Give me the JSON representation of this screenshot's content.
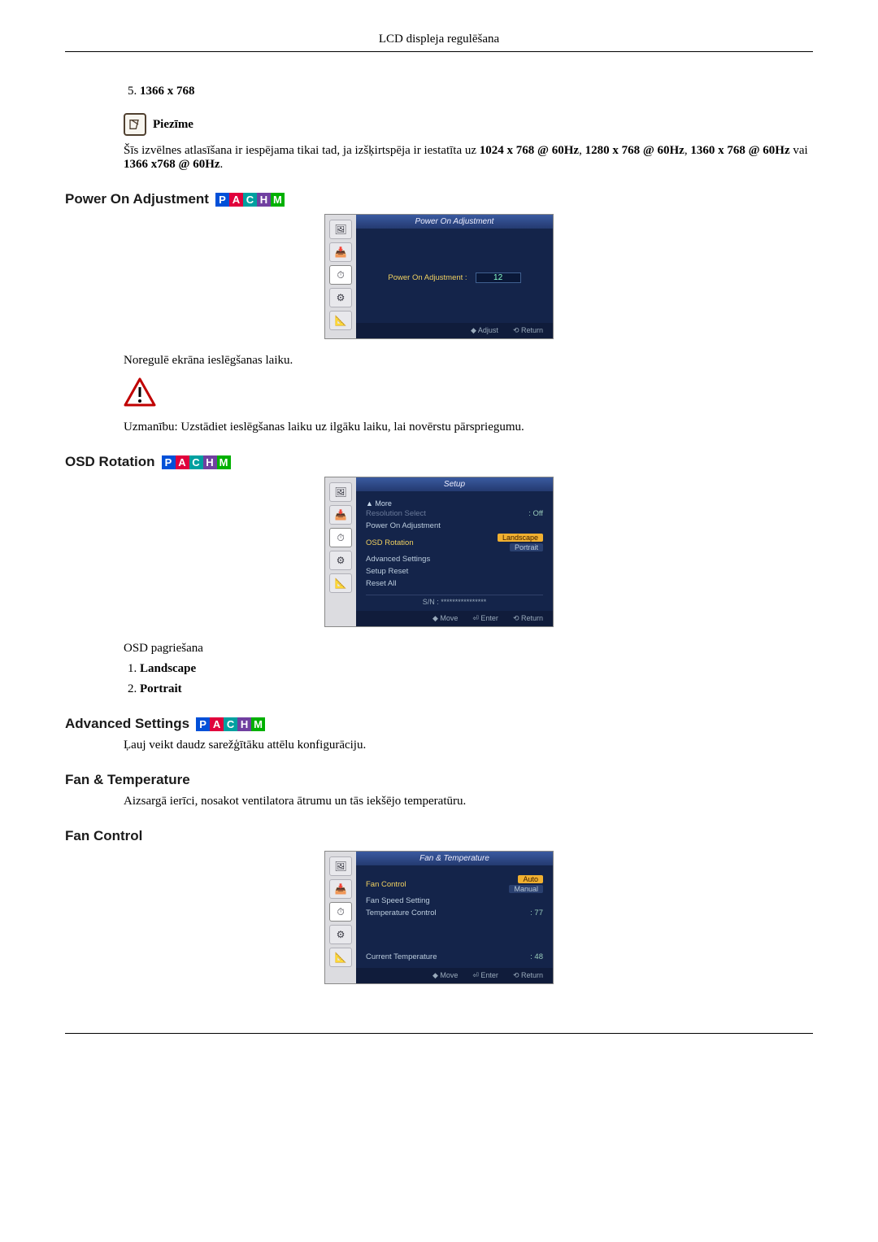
{
  "header": "LCD displeja regulēšana",
  "resolution_list_start": 5,
  "resolution_list": [
    "1366 x 768"
  ],
  "note_label": "Piezīme",
  "note_text": "Šīs izvēlnes atlasīšana ir iespējama tikai tad, ja izšķirtspēja ir iestatīta uz ",
  "note_bold1": "1024 x 768 @ 60Hz",
  "note_sep1": ", ",
  "note_bold2": "1280 x 768 @ 60Hz",
  "note_sep2": ", ",
  "note_bold3": "1360 x 768 @ 60Hz",
  "note_sep3": " vai ",
  "note_bold4": "1366 x768 @ 60Hz",
  "note_end": ".",
  "power_on": {
    "heading": "Power On Adjustment",
    "osd_title": "Power On Adjustment",
    "row_label": "Power On Adjustment :",
    "row_value": "12",
    "footer_adjust": "◆ Adjust",
    "footer_return": "⟲ Return",
    "desc": "Noregulē ekrāna ieslēgšanas laiku.",
    "warn": "Uzmanību: Uzstādiet ieslēgšanas laiku uz ilgāku laiku, lai novērstu pārspriegumu."
  },
  "osd_rotation": {
    "heading": "OSD Rotation",
    "osd_title": "Setup",
    "more": "▲ More",
    "items": [
      {
        "label": "Resolution Select",
        "value": ": Off",
        "dim": true
      },
      {
        "label": "Power On Adjustment",
        "value": ""
      },
      {
        "label": "OSD Rotation",
        "value": "Landscape",
        "hi": true,
        "pill": true,
        "extra": "Portrait"
      },
      {
        "label": "Advanced Settings",
        "value": ""
      },
      {
        "label": "Setup Reset",
        "value": ""
      },
      {
        "label": "Reset All",
        "value": ""
      }
    ],
    "sn": "S/N : ****************",
    "footer_move": "◆ Move",
    "footer_enter": "⏎ Enter",
    "footer_return": "⟲ Return",
    "desc": "OSD pagriešana",
    "options": [
      "Landscape",
      "Portrait"
    ]
  },
  "advanced": {
    "heading": "Advanced Settings",
    "desc": "Ļauj veikt daudz sarežģītāku attēlu konfigurāciju."
  },
  "fan_temp": {
    "heading": "Fan & Temperature",
    "desc": "Aizsargā ierīci, nosakot ventilatora ātrumu un tās iekšējo temperatūru."
  },
  "fan_control": {
    "heading": "Fan Control",
    "osd_title": "Fan & Temperature",
    "items": [
      {
        "label": "Fan Control",
        "value": "Auto",
        "hi": true,
        "pill": true,
        "extra": "Manual"
      },
      {
        "label": "Fan Speed Setting",
        "value": ""
      },
      {
        "label": "Temperature Control",
        "value": ": 77"
      }
    ],
    "current_label": "Current Temperature",
    "current_value": ": 48",
    "footer_move": "◆ Move",
    "footer_enter": "⏎ Enter",
    "footer_return": "⟲ Return"
  }
}
